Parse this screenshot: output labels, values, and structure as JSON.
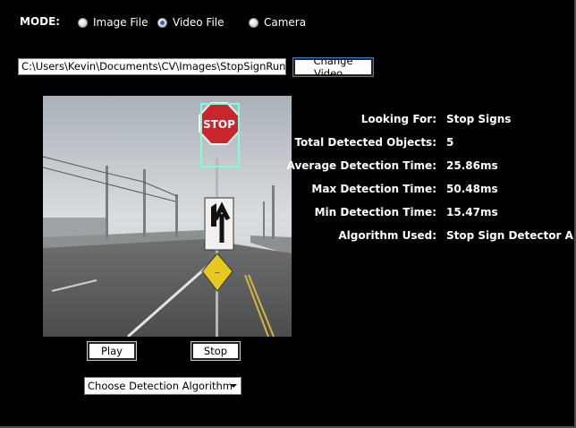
{
  "mode": {
    "label": "MODE:",
    "options": [
      {
        "label": "Image File",
        "selected": false
      },
      {
        "label": "Video File",
        "selected": true
      },
      {
        "label": "Camera",
        "selected": false
      }
    ]
  },
  "file": {
    "path": "C:\\Users\\Kevin\\Documents\\CV\\Images\\StopSignRun.avi",
    "change_label": "Change Video..."
  },
  "video": {
    "sign_text": "STOP"
  },
  "stats": [
    {
      "label": "Looking For:",
      "value": "Stop Signs"
    },
    {
      "label": "Total Detected Objects:",
      "value": "5"
    },
    {
      "label": "Average Detection Time:",
      "value": "25.86ms"
    },
    {
      "label": "Max Detection Time:",
      "value": "50.48ms"
    },
    {
      "label": "Min Detection Time:",
      "value": "15.47ms"
    },
    {
      "label": "Algorithm Used:",
      "value": "Stop Sign Detector A"
    }
  ],
  "controls": {
    "play_label": "Play",
    "stop_label": "Stop",
    "algorithm_select": "Choose Detection Algorithm"
  },
  "colors": {
    "background": "#000000",
    "detection_box": "#7fffd4",
    "stop_sign": "#c8252c",
    "radio_selected": "#2c63c8"
  }
}
